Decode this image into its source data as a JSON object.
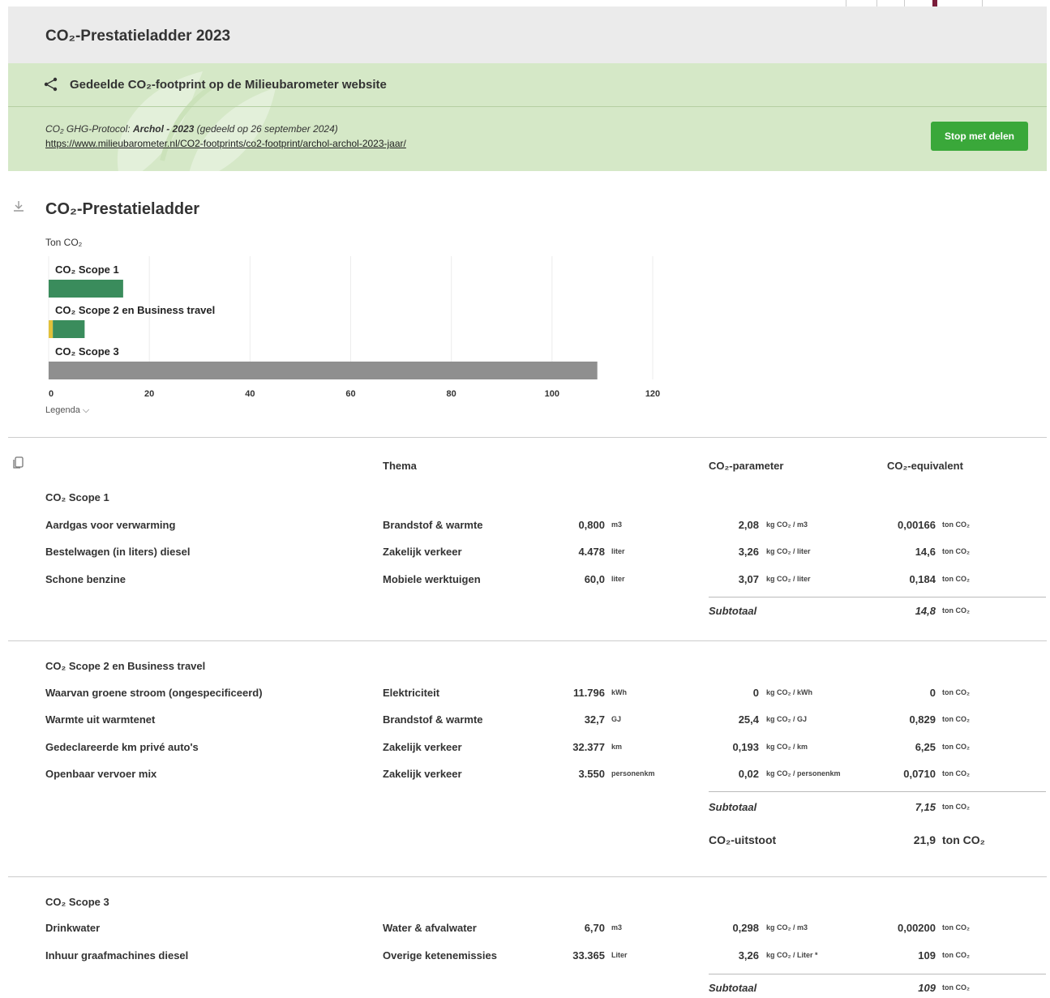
{
  "header": {
    "title": "CO₂-Prestatieladder 2023"
  },
  "share": {
    "heading": "Gedeelde CO₂-footprint op de Milieubarometer website",
    "meta_prefix": "CO₂ GHG-Protocol: ",
    "meta_org": "Archol - 2023",
    "meta_suffix": " (gedeeld op 26 september 2024)",
    "link": "https://www.milieubarometer.nl/CO2-footprints/co2-footprint/archol-archol-2023-jaar/",
    "stop_label": "Stop met delen"
  },
  "chart_section": {
    "title": "CO₂-Prestatieladder",
    "unit_label": "Ton CO₂",
    "legend_label": "Legenda ⌵"
  },
  "chart_data": {
    "type": "bar",
    "orientation": "horizontal",
    "stacked": true,
    "categories": [
      "CO₂ Scope 1",
      "CO₂ Scope 2 en Business travel",
      "CO₂ Scope 3"
    ],
    "series": [
      {
        "values": [
          0,
          0.829,
          0
        ],
        "color": "#e2c13a"
      },
      {
        "values": [
          14.8,
          6.32,
          0
        ],
        "color": "#3a8c5c"
      },
      {
        "values": [
          0,
          0,
          109
        ],
        "color": "#8f8f8f"
      }
    ],
    "xticks": [
      0,
      20,
      40,
      60,
      80,
      100,
      120
    ],
    "xlim": [
      0,
      120
    ],
    "grid": true
  },
  "table": {
    "headers": {
      "thema": "Thema",
      "parameter": "CO₂-parameter",
      "equivalent": "CO₂-equivalent"
    },
    "scope1": {
      "title": "CO₂ Scope 1",
      "rows": [
        {
          "name": "Aardgas voor verwarming",
          "thema": "Brandstof & warmte",
          "qty": "0,800",
          "qty_unit": "m3",
          "factor": "2,08",
          "factor_unit": "kg CO₂ / m3",
          "eq": "0,00166",
          "eq_unit": "ton CO₂"
        },
        {
          "name": "Bestelwagen (in liters) diesel",
          "thema": "Zakelijk verkeer",
          "qty": "4.478",
          "qty_unit": "liter",
          "factor": "3,26",
          "factor_unit": "kg CO₂ / liter",
          "eq": "14,6",
          "eq_unit": "ton CO₂"
        },
        {
          "name": "Schone benzine",
          "thema": "Mobiele werktuigen",
          "qty": "60,0",
          "qty_unit": "liter",
          "factor": "3,07",
          "factor_unit": "kg CO₂ / liter",
          "eq": "0,184",
          "eq_unit": "ton CO₂"
        }
      ],
      "subtotal_label": "Subtotaal",
      "subtotal": "14,8",
      "subtotal_unit": "ton CO₂"
    },
    "scope2": {
      "title": "CO₂ Scope 2 en Business travel",
      "rows": [
        {
          "name": "Waarvan groene stroom (ongespecificeerd)",
          "thema": "Elektriciteit",
          "qty": "11.796",
          "qty_unit": "kWh",
          "factor": "0",
          "factor_unit": "kg CO₂ / kWh",
          "eq": "0",
          "eq_unit": "ton CO₂"
        },
        {
          "name": "Warmte uit warmtenet",
          "thema": "Brandstof & warmte",
          "qty": "32,7",
          "qty_unit": "GJ",
          "factor": "25,4",
          "factor_unit": "kg CO₂ / GJ",
          "eq": "0,829",
          "eq_unit": "ton CO₂"
        },
        {
          "name": "Gedeclareerde km privé auto's",
          "thema": "Zakelijk verkeer",
          "qty": "32.377",
          "qty_unit": "km",
          "factor": "0,193",
          "factor_unit": "kg CO₂ / km",
          "eq": "6,25",
          "eq_unit": "ton CO₂"
        },
        {
          "name": "Openbaar vervoer mix",
          "thema": "Zakelijk verkeer",
          "qty": "3.550",
          "qty_unit": "personenkm",
          "factor": "0,02",
          "factor_unit": "kg CO₂ / personenkm",
          "eq": "0,0710",
          "eq_unit": "ton CO₂"
        }
      ],
      "subtotal_label": "Subtotaal",
      "subtotal": "7,15",
      "subtotal_unit": "ton CO₂",
      "total_label": "CO₂-uitstoot",
      "total": "21,9",
      "total_unit": "ton CO₂"
    },
    "scope3": {
      "title": "CO₂ Scope 3",
      "rows": [
        {
          "name": "Drinkwater",
          "thema": "Water & afvalwater",
          "qty": "6,70",
          "qty_unit": "m3",
          "factor": "0,298",
          "factor_unit": "kg CO₂ / m3",
          "eq": "0,00200",
          "eq_unit": "ton CO₂"
        },
        {
          "name": "Inhuur graafmachines diesel",
          "thema": "Overige ketenemissies",
          "qty": "33.365",
          "qty_unit": "Liter",
          "factor": "3,26",
          "factor_unit": "kg CO₂ / Liter *",
          "eq": "109",
          "eq_unit": "ton CO₂"
        }
      ],
      "subtotal_label": "Subtotaal",
      "subtotal": "109",
      "subtotal_unit": "ton CO₂"
    }
  }
}
